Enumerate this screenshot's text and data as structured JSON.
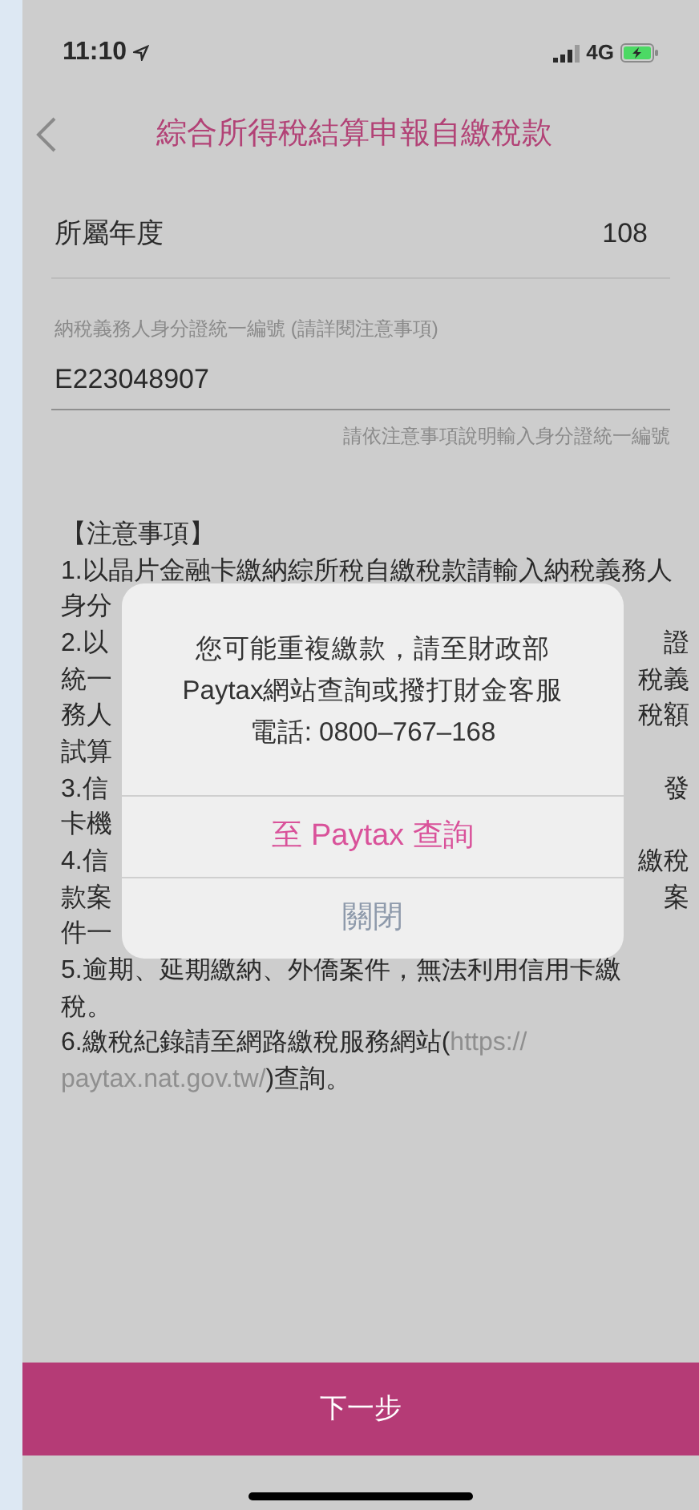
{
  "status_bar": {
    "time": "11:10",
    "network": "4G"
  },
  "header": {
    "title": "綜合所得稅結算申報自繳稅款"
  },
  "year": {
    "label": "所屬年度",
    "value": "108"
  },
  "id_field": {
    "label": "納稅義務人身分證統一編號 (請詳閱注意事項)",
    "value": "E223048907",
    "hint": "請依注意事項說明輸入身分證統一編號"
  },
  "notes": {
    "title": "【注意事項】",
    "rows": [
      {
        "left": "1.以晶片金融卡繳納綜所稅自繳稅款請輸入納稅義務人"
      },
      {
        "left": "身分"
      },
      {
        "left": "2.以",
        "right": "證"
      },
      {
        "left": "統一",
        "right": "稅義"
      },
      {
        "left": "務人",
        "right": "稅額"
      },
      {
        "left": "試算"
      },
      {
        "left": "3.信",
        "right": "發"
      },
      {
        "left": "卡機"
      },
      {
        "left": "4.信",
        "right": "繳稅"
      },
      {
        "left": "款案",
        "right": "案"
      },
      {
        "left": "件一"
      },
      {
        "left": "5.逾期、延期繳納、外僑案件，無法利用信用卡繳"
      },
      {
        "left": "稅。"
      },
      {
        "segments": [
          {
            "kind": "text",
            "text": "6.繳稅紀錄請至網路繳稅服務網站("
          },
          {
            "kind": "link",
            "text": "https://"
          }
        ]
      },
      {
        "segments": [
          {
            "kind": "link",
            "text": "paytax.nat.gov.tw/"
          },
          {
            "kind": "text",
            "text": ")查詢。"
          }
        ]
      }
    ]
  },
  "dialog": {
    "message": [
      "您可能重複繳款，請至財政部",
      "Paytax網站查詢或撥打財金客服",
      "電話: 0800–767–168"
    ],
    "buttons": [
      {
        "label": "至 Paytax 查詢",
        "kind": "primary"
      },
      {
        "label": "關閉",
        "kind": "cancel"
      }
    ]
  },
  "next_button": {
    "label": "下一步"
  }
}
